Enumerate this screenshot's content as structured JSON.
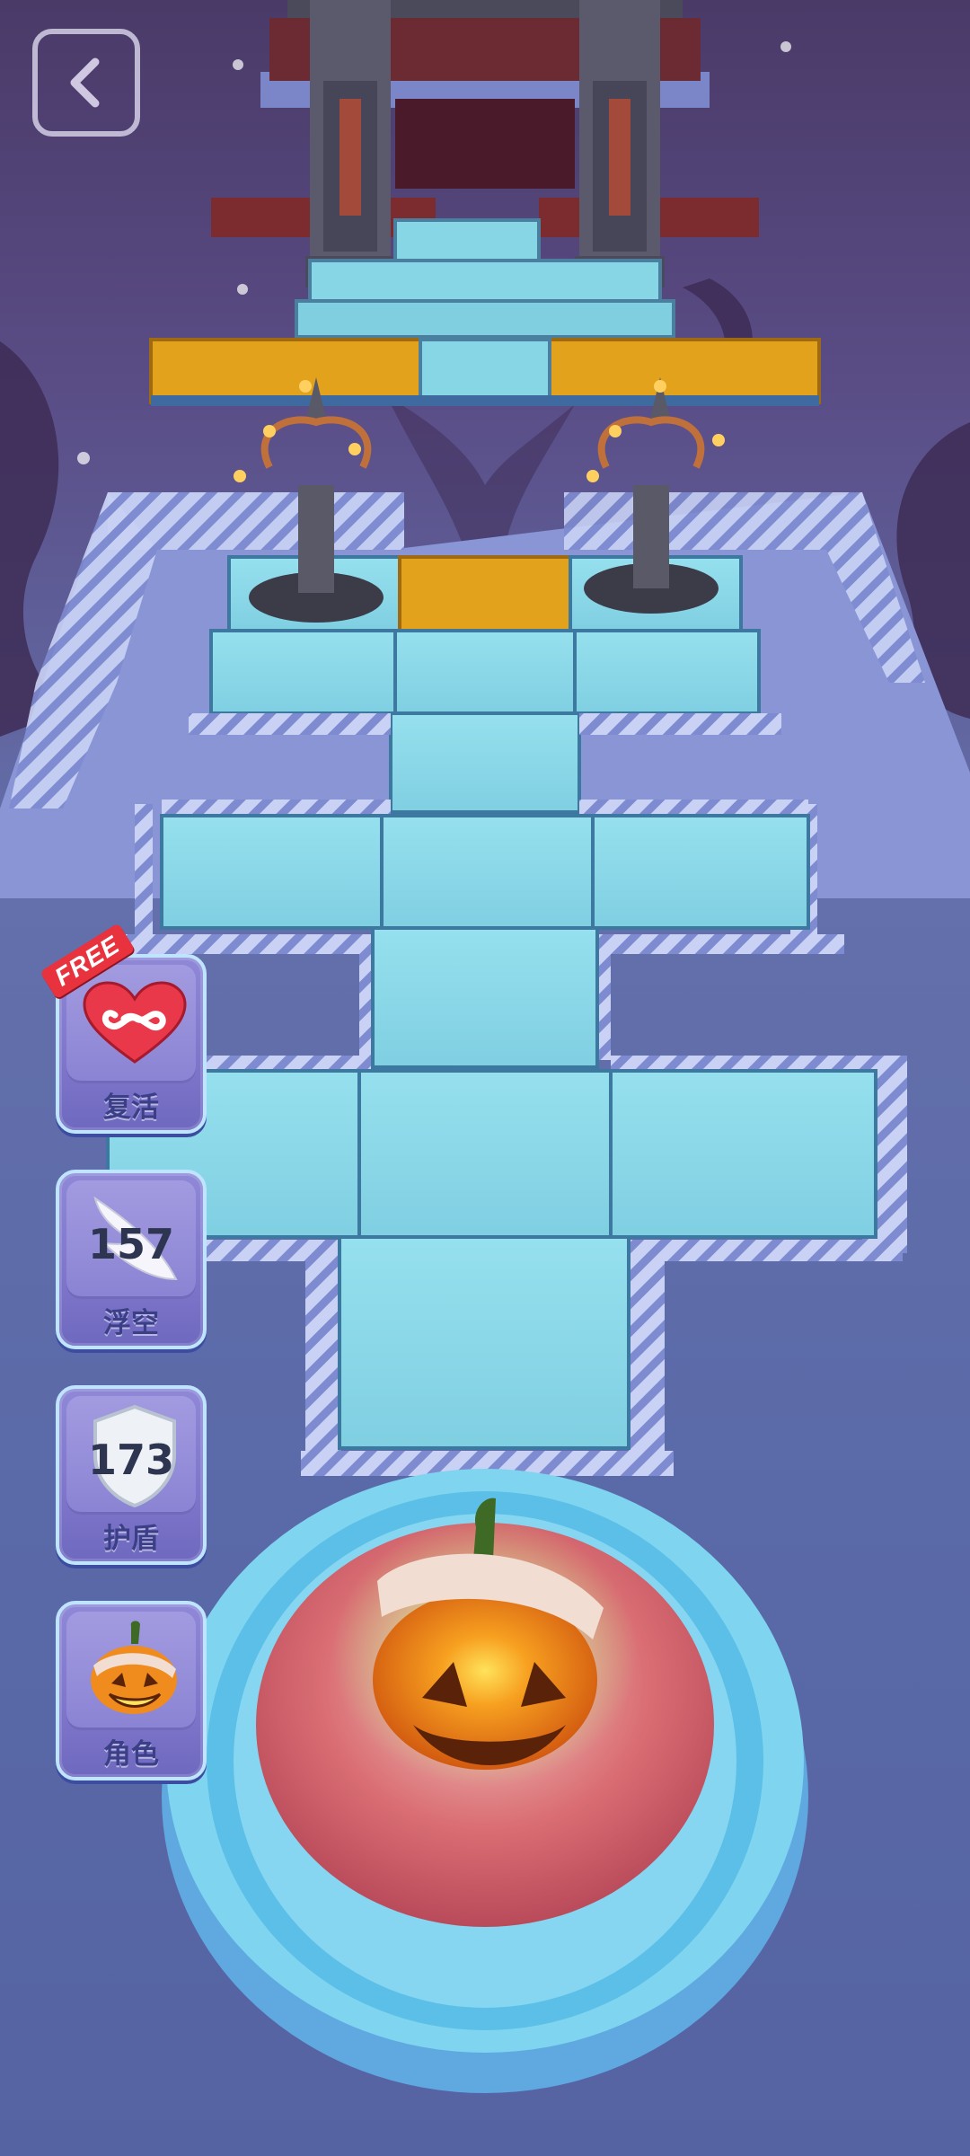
{
  "hud": {
    "back_icon": "chevron-left-icon"
  },
  "powerups": [
    {
      "id": "revive",
      "label": "复活",
      "icon": "infinity-heart-icon",
      "badge": "FREE"
    },
    {
      "id": "float",
      "label": "浮空",
      "icon": "wing-icon",
      "count": "157"
    },
    {
      "id": "shield",
      "label": "护盾",
      "icon": "shield-icon",
      "count": "173"
    },
    {
      "id": "character",
      "label": "角色",
      "icon": "pumpkin-icon"
    }
  ],
  "colors": {
    "tile": "#86d6e6",
    "gold_tile": "#e2a21b",
    "platform": "#8b96d8",
    "heart": "#e8384a"
  }
}
